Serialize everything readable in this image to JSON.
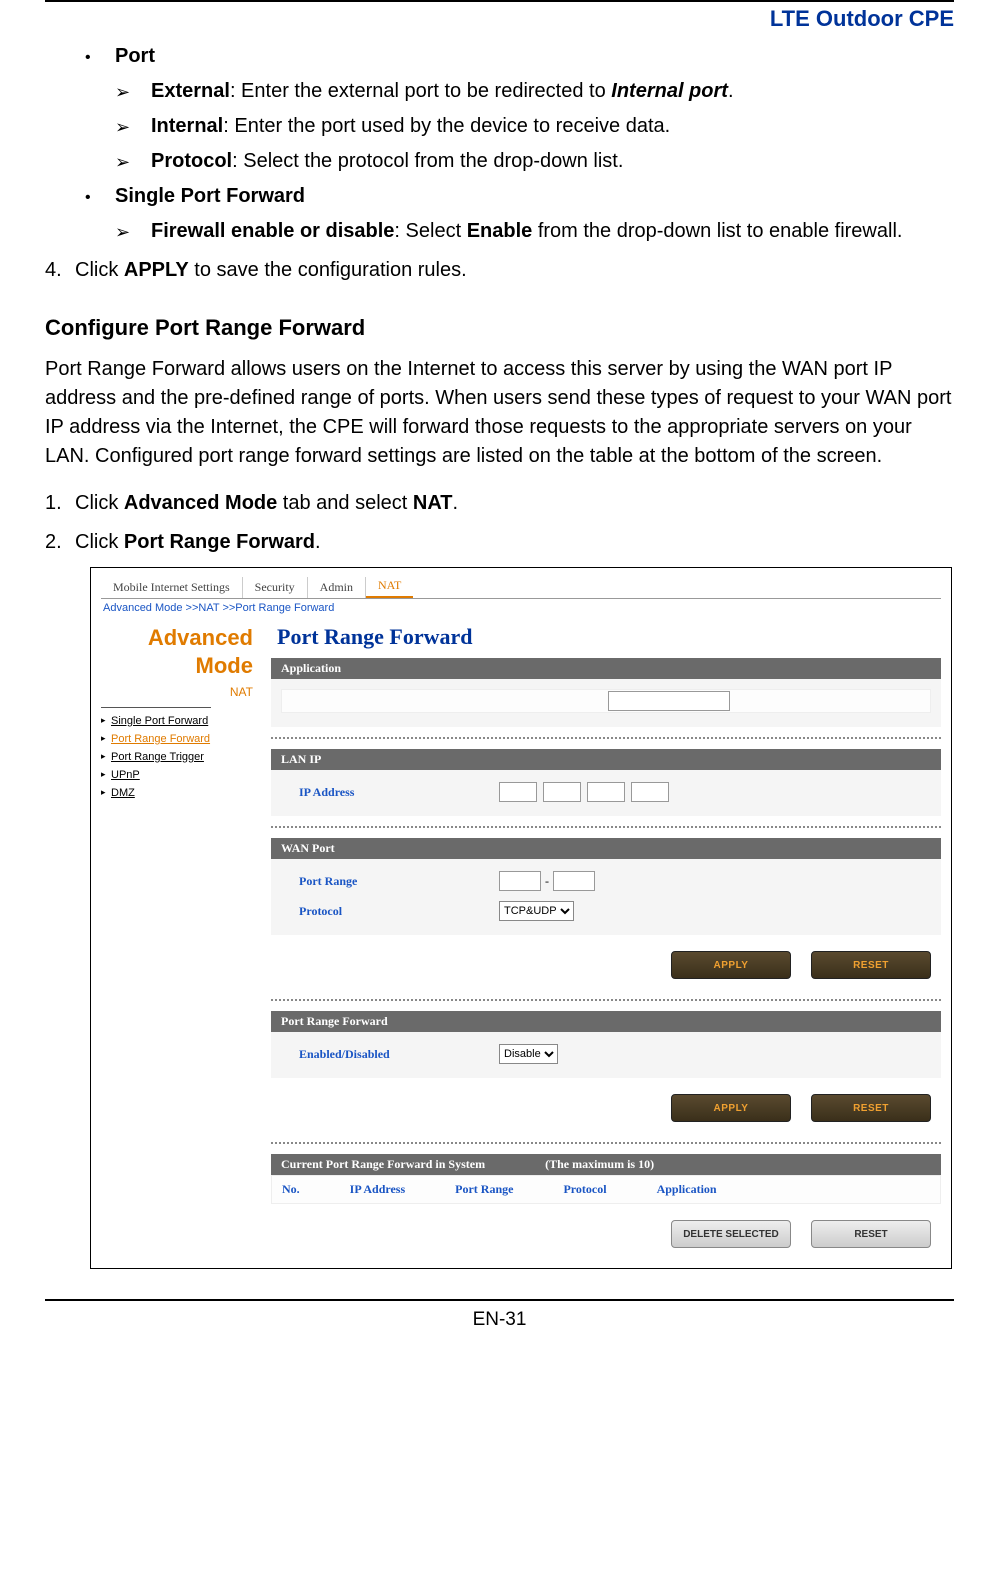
{
  "doc": {
    "title": "LTE Outdoor CPE",
    "page_number": "EN-31"
  },
  "content": {
    "port_heading": "Port",
    "ext_label": "External",
    "ext_text": ": Enter the external port to be redirected to ",
    "ext_ital": "Internal port",
    "ext_tail": ".",
    "int_label": "Internal",
    "int_text": ": Enter the port used by the device to receive data.",
    "proto_label": "Protocol",
    "proto_text": ": Select the protocol from the drop-down list.",
    "spf_heading": "Single Port Forward",
    "fw_label": "Firewall enable or disable",
    "fw_text_a": ": Select ",
    "fw_bold": "Enable",
    "fw_text_b": " from the drop-down list to enable firewall.",
    "step4_num": "4.",
    "step4_a": "Click ",
    "step4_b": "APPLY",
    "step4_c": " to save the configuration rules.",
    "section_head": "Configure Port Range Forward",
    "paragraph": "Port Range Forward allows users on the Internet to access this server by using the WAN port IP address and the pre-defined range of ports. When users send these types of request to your WAN port IP address via the Internet, the CPE will forward those requests to the appropriate servers on your LAN. Configured port range forward settings are listed on the table at the bottom of the screen.",
    "step1_num": "1.",
    "step1_a": "Click ",
    "step1_b": "Advanced Mode",
    "step1_c": " tab and select ",
    "step1_d": "NAT",
    "step1_e": ".",
    "step2_num": "2.",
    "step2_a": "Click ",
    "step2_b": "Port Range Forward",
    "step2_c": "."
  },
  "ui": {
    "tabs": [
      "Mobile Internet Settings",
      "Security",
      "Admin",
      "NAT"
    ],
    "breadcrumb": "Advanced Mode >>NAT >>Port Range Forward",
    "adv_label_1": "Advanced",
    "adv_label_2": "Mode",
    "nat_label": "NAT",
    "side_items": [
      "Single Port Forward",
      "Port Range Forward",
      "Port Range Trigger",
      "UPnP",
      "DMZ"
    ],
    "panel_title": "Port Range Forward",
    "sect_application": "Application",
    "sect_lanip": "LAN IP",
    "ip_label": "IP Address",
    "sect_wan": "WAN Port",
    "port_range_label": "Port Range",
    "range_dash": "-",
    "protocol_label": "Protocol",
    "protocol_value": "TCP&UDP",
    "apply_btn": "APPLY",
    "reset_btn": "RESET",
    "sect_prf": "Port Range Forward",
    "enabled_label": "Enabled/Disabled",
    "enabled_value": "Disable",
    "current_head": "Current Port Range Forward in System",
    "max_note": "(The maximum is 10)",
    "cols": [
      "No.",
      "IP Address",
      "Port Range",
      "Protocol",
      "Application"
    ],
    "delete_btn": "DELETE SELECTED",
    "reset_btn2": "RESET"
  }
}
